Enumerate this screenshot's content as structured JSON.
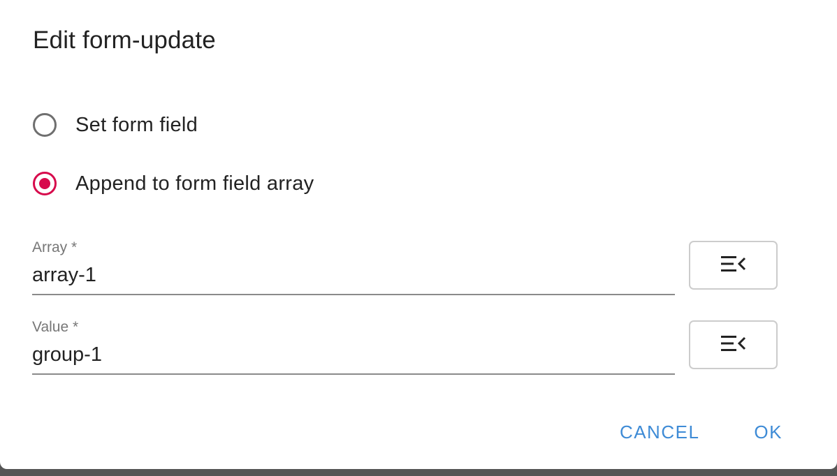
{
  "dialog": {
    "title": "Edit form-update",
    "options": [
      {
        "label": "Set form field",
        "checked": false
      },
      {
        "label": "Append to form field array",
        "checked": true
      }
    ],
    "fields": [
      {
        "label": "Array *",
        "value": "array-1",
        "button_icon": "list-collapse-icon"
      },
      {
        "label": "Value *",
        "value": "group-1",
        "button_icon": "list-collapse-icon"
      }
    ],
    "actions": {
      "cancel_label": "CANCEL",
      "ok_label": "OK"
    },
    "colors": {
      "accent_radio": "#d70a4c",
      "action_text": "#3e8bd6"
    }
  }
}
